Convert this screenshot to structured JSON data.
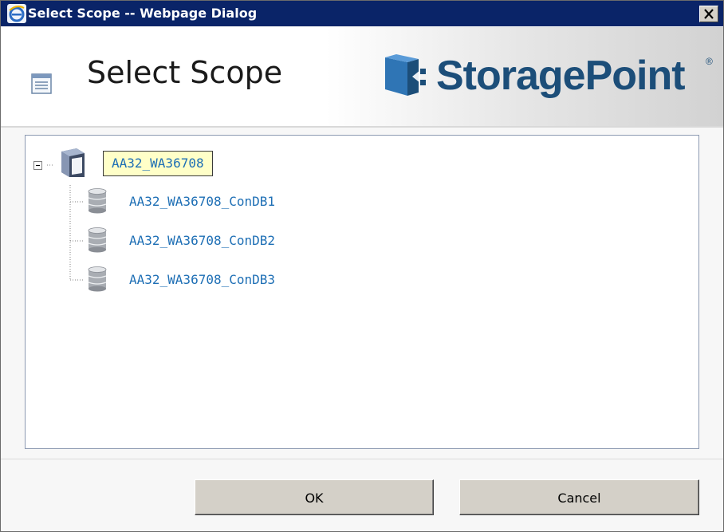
{
  "window": {
    "title": "Select Scope -- Webpage Dialog",
    "icon": "ie-icon"
  },
  "header": {
    "title": "Select Scope",
    "logo_text": "StoragePoint",
    "logo_mark": "®"
  },
  "tree": {
    "root": {
      "label": "AA32_WA36708",
      "icon": "server-icon",
      "expanded": true,
      "selected": true
    },
    "children": [
      {
        "label": "AA32_WA36708_ConDB1",
        "icon": "database-icon"
      },
      {
        "label": "AA32_WA36708_ConDB2",
        "icon": "database-icon"
      },
      {
        "label": "AA32_WA36708_ConDB3",
        "icon": "database-icon"
      }
    ]
  },
  "buttons": {
    "ok_label": "OK",
    "cancel_label": "Cancel"
  },
  "colors": {
    "titlebar": "#0a2468",
    "link": "#1e6fb5",
    "logo": "#1c4e79",
    "selection_bg": "#ffffc8"
  }
}
